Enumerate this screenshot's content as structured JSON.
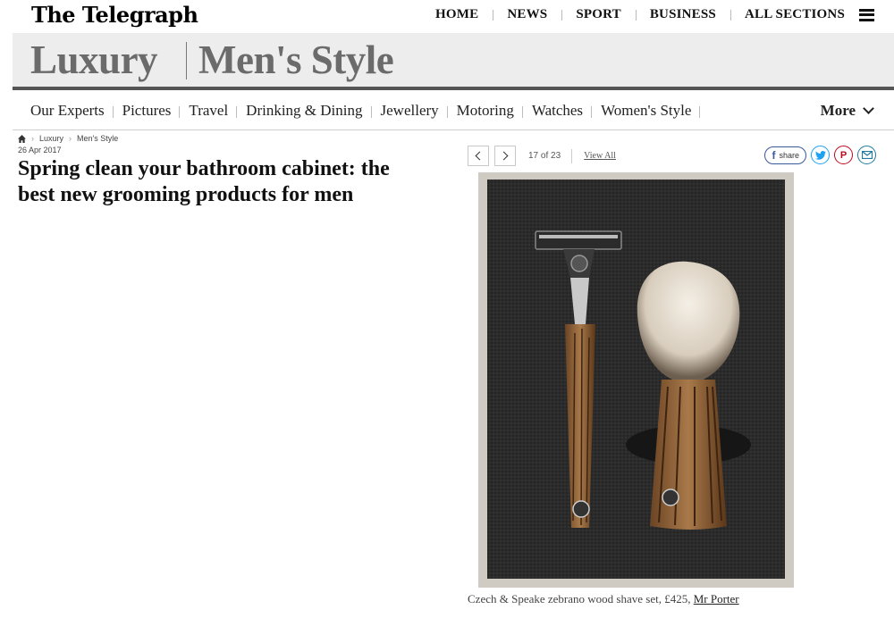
{
  "header": {
    "logo": "The Telegraph",
    "nav": [
      "HOME",
      "NEWS",
      "SPORT",
      "BUSINESS",
      "ALL SECTIONS"
    ]
  },
  "banner": {
    "section": "Luxury",
    "subsection": "Men's Style"
  },
  "subnav": {
    "links": [
      "Our Experts",
      "Pictures",
      "Travel",
      "Drinking & Dining",
      "Jewellery",
      "Motoring",
      "Watches",
      "Women's Style"
    ],
    "more_label": "More"
  },
  "breadcrumb": [
    "Luxury",
    "Men's Style"
  ],
  "article": {
    "date": "26 Apr 2017",
    "headline": "Spring clean your bathroom cabinet: the best new grooming products for men"
  },
  "gallery": {
    "counter": "17 of 23",
    "view_all": "View All",
    "share_label": "share",
    "caption_text": "Czech & Speake zebrano wood shave set, £425, ",
    "caption_link": "Mr Porter"
  },
  "colors": {
    "facebook": "#3b5998",
    "twitter": "#1da1f2",
    "pinterest": "#bd081c",
    "email": "#1e7a9e",
    "banner_bg": "#ededed",
    "banner_text": "#6b6b6b"
  }
}
